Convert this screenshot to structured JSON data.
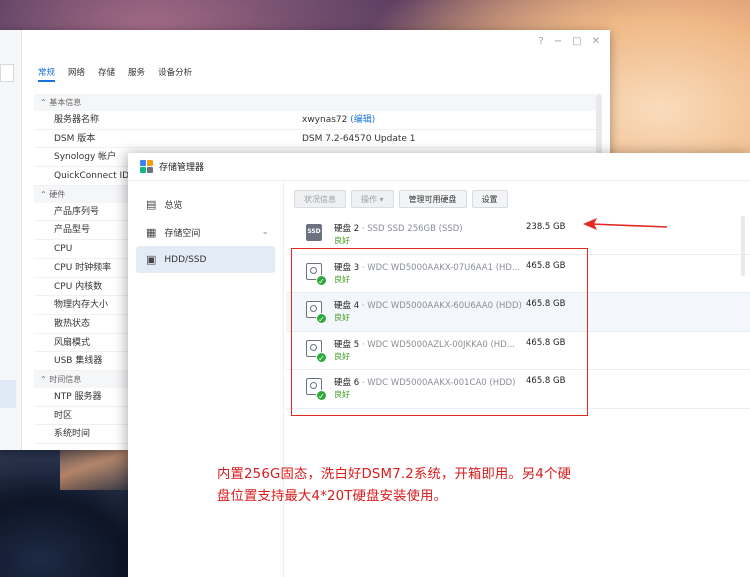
{
  "back_window": {
    "tabs": [
      {
        "label": "常规",
        "active": true
      },
      {
        "label": "网络"
      },
      {
        "label": "存储"
      },
      {
        "label": "服务"
      },
      {
        "label": "设备分析"
      }
    ],
    "controls": {
      "help": "?",
      "min": "−",
      "max": "□",
      "close": "✕"
    },
    "sections": [
      {
        "title": "基本信息",
        "rows": [
          {
            "key": "服务器名称",
            "value": "xwynas72",
            "link": "(编辑)"
          },
          {
            "key": "DSM 版本",
            "value": "DSM 7.2-64570 Update 1"
          },
          {
            "key": "Synology 帐户",
            "value": ""
          },
          {
            "key": "QuickConnect ID",
            "value": ""
          }
        ]
      },
      {
        "title": "硬件",
        "rows": [
          {
            "key": "产品序列号",
            "value": ""
          },
          {
            "key": "产品型号",
            "value": ""
          },
          {
            "key": "CPU",
            "value": ""
          },
          {
            "key": "CPU 时钟频率",
            "value": ""
          },
          {
            "key": "CPU 内核数",
            "value": ""
          },
          {
            "key": "物理内存大小",
            "value": ""
          },
          {
            "key": "散热状态",
            "value": ""
          },
          {
            "key": "风扇模式",
            "value": ""
          },
          {
            "key": "USB 集线器",
            "value": ""
          }
        ]
      },
      {
        "title": "时间信息",
        "rows": [
          {
            "key": "NTP 服务器",
            "value": ""
          },
          {
            "key": "时区",
            "value": ""
          },
          {
            "key": "系统时间",
            "value": ""
          }
        ]
      }
    ]
  },
  "storage_manager": {
    "title": "存储管理器",
    "nav": [
      {
        "label": "总览",
        "icon": "overview-icon"
      },
      {
        "label": "存储空间",
        "icon": "storage-icon",
        "chevron": "⌄"
      },
      {
        "label": "HDD/SSD",
        "icon": "hdd-icon",
        "selected": true
      }
    ],
    "toolbar": [
      {
        "label": "状况信息",
        "disabled": true
      },
      {
        "label": "操作 ▾",
        "disabled": true
      },
      {
        "label": "管理可用硬盘"
      },
      {
        "label": "设置"
      }
    ],
    "drives": [
      {
        "name": "硬盘 2",
        "model": " · SSD SSD 256GB (SSD)",
        "status": "良好",
        "size": "238.5 GB",
        "type": "ssd",
        "badge": "SSD"
      },
      {
        "name": "硬盘 3",
        "model": " · WDC WD5000AAKX-07U6AA1 (HD...",
        "status": "良好",
        "size": "465.8 GB",
        "type": "hdd"
      },
      {
        "name": "硬盘 4",
        "model": " · WDC WD5000AAKX-60U6AA0 (HDD)",
        "status": "良好",
        "size": "465.8 GB",
        "type": "hdd"
      },
      {
        "name": "硬盘 5",
        "model": " · WDC WD5000AZLX-00JKKA0 (HD...",
        "status": "良好",
        "size": "465.8 GB",
        "type": "hdd"
      },
      {
        "name": "硬盘 6",
        "model": " · WDC WD5000AAKX-001CA0 (HDD)",
        "status": "良好",
        "size": "465.8 GB",
        "type": "hdd"
      }
    ]
  },
  "annotation": {
    "caption_line1": "内置256G固态，洗白好DSM7.2系统，开箱即用。另4个硬",
    "caption_line2": "盘位置支持最大4*20T硬盘安装使用。",
    "color": "#e22a22"
  }
}
